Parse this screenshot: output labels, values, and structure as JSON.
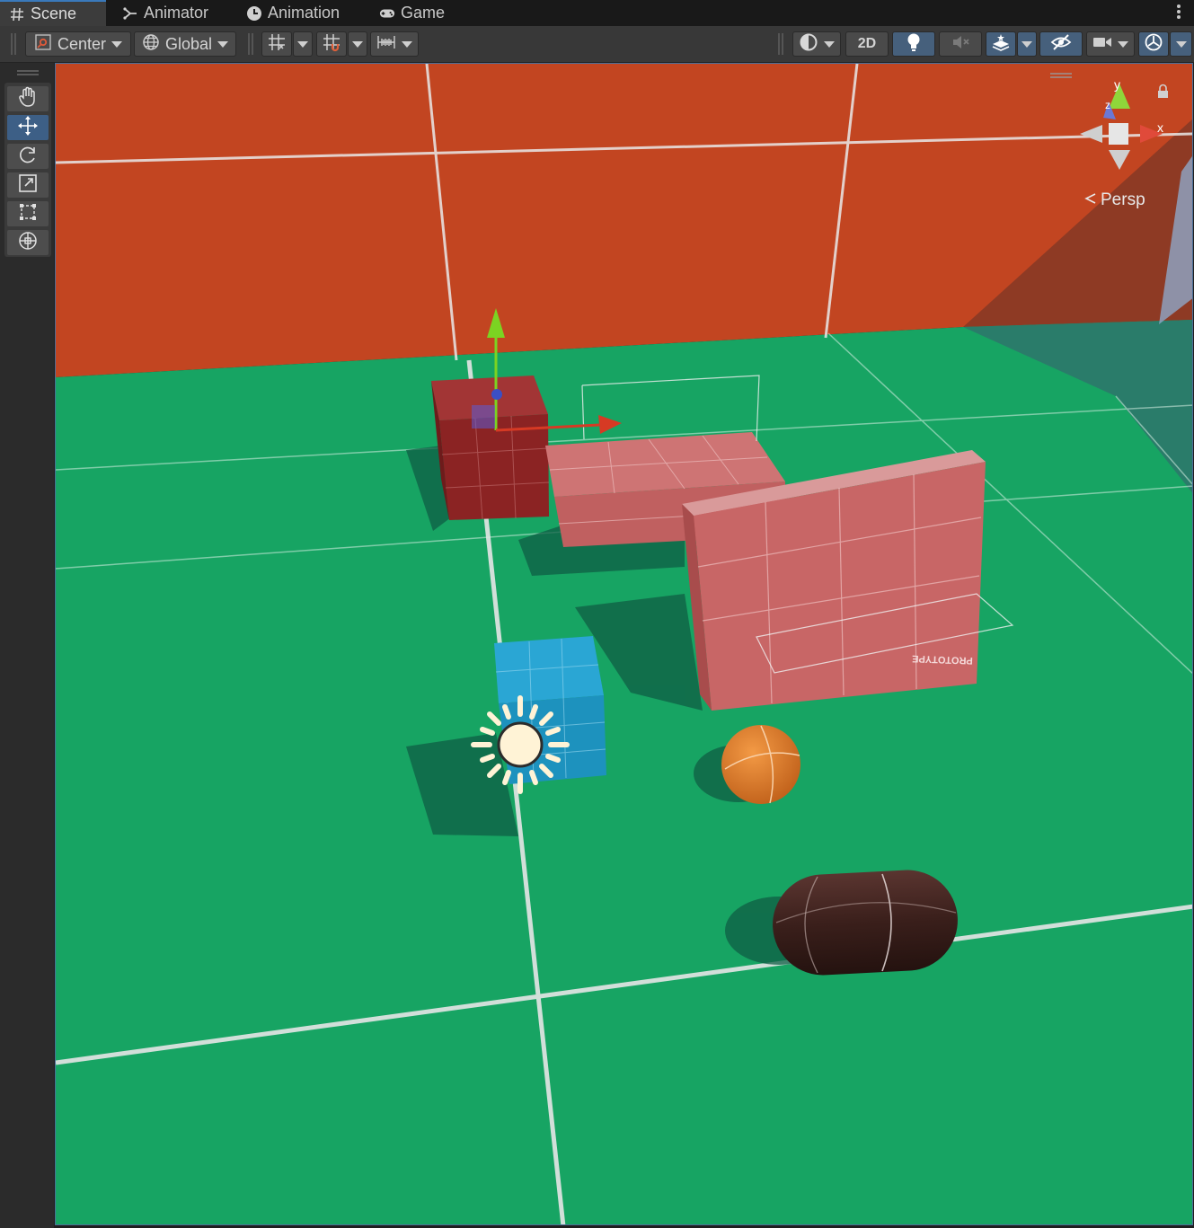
{
  "tabs": [
    {
      "label": "Scene",
      "icon": "hash-icon",
      "active": true
    },
    {
      "label": "Animator",
      "icon": "animator-icon",
      "active": false
    },
    {
      "label": "Animation",
      "icon": "clock-icon",
      "active": false
    },
    {
      "label": "Game",
      "icon": "gamepad-icon",
      "active": false
    }
  ],
  "toolbar": {
    "pivot_label": "Center",
    "space_label": "Global",
    "mode_2d_label": "2D",
    "icons": [
      "grid-snap-icon",
      "snap-increment-icon",
      "ruler-icon",
      "shading-mode-icon",
      "lighting-icon",
      "audio-mute-icon",
      "effects-icon",
      "hidden-objects-icon",
      "camera-icon",
      "gizmos-icon"
    ]
  },
  "tools": [
    "hand-tool-icon",
    "move-tool-icon",
    "rotate-tool-icon",
    "scale-tool-icon",
    "rect-tool-icon",
    "transform-tool-icon"
  ],
  "active_tool": "move-tool-icon",
  "gizmo": {
    "x_label": "x",
    "y_label": "y",
    "z_label": "z",
    "projection_label": "Persp"
  },
  "scene_text": {
    "prototype_label": "PROTOTYPE"
  },
  "colors": {
    "accent": "#3a79bb",
    "wall": "#c24521",
    "floor": "#1aa364",
    "selected_cube": "#8b2323",
    "pink_blocks": "#c86666",
    "blue_cube": "#1d9bc8",
    "sphere": "#e07a25",
    "capsule": "#3b1f1a",
    "light_icon": "#fff3d6"
  }
}
